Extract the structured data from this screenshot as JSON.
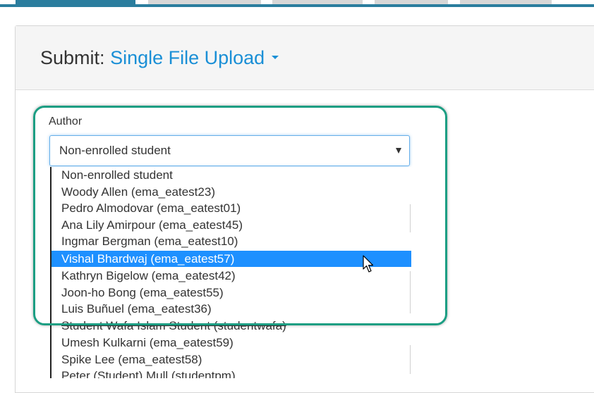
{
  "tabs": [
    {
      "label": "",
      "active": true
    },
    {
      "label": "",
      "active": false
    },
    {
      "label": "",
      "active": false
    },
    {
      "label": "",
      "active": false
    },
    {
      "label": "",
      "active": false
    }
  ],
  "header": {
    "submit_label": "Submit:",
    "mode_label": "Single File Upload"
  },
  "author": {
    "label": "Author",
    "selected_value": "Non-enrolled student",
    "options": [
      "Non-enrolled student",
      "Woody Allen (ema_eatest23)",
      "Pedro Almodovar (ema_eatest01)",
      "Ana Lily Amirpour (ema_eatest45)",
      "Ingmar Bergman (ema_eatest10)",
      "Vishal Bhardwaj (ema_eatest57)",
      "Kathryn Bigelow (ema_eatest42)",
      "Joon-ho Bong (ema_eatest55)",
      "Luis Buñuel (ema_eatest36)",
      "Student Wafa Islam Student (studentwafa)",
      "Umesh Kulkarni (ema_eatest59)",
      "Spike Lee (ema_eatest58)",
      "Peter (Student) Mull (studentpm)"
    ],
    "highlighted_option": "Vishal Bhardwaj (ema_eatest57)"
  },
  "colors": {
    "accent": "#2a7d9e",
    "link": "#1a8fd6",
    "selection": "#1e90ff",
    "highlight_frame": "#1c9e83"
  }
}
